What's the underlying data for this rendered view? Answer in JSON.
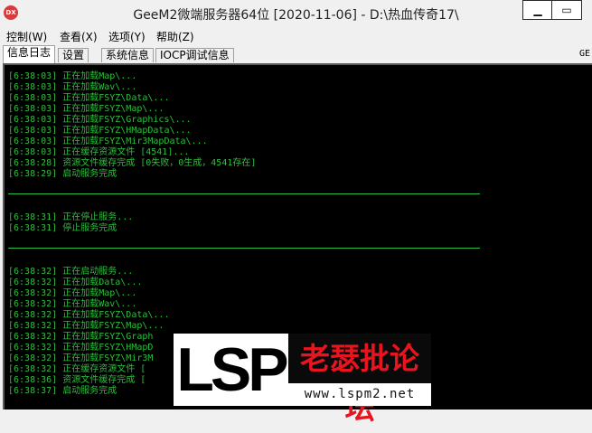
{
  "window": {
    "title": "GeeM2微端服务器64位 [2020-11-06] - D:\\热血传奇17\\",
    "app_icon": "DX",
    "minimize_symbol": "▁",
    "maximize_symbol": "▭"
  },
  "menu": {
    "items": [
      "控制(W)",
      "查看(X)",
      "选项(Y)",
      "帮助(Z)"
    ]
  },
  "tabs": {
    "items": [
      "信息日志",
      "设置",
      "系统信息",
      "IOCP调试信息"
    ],
    "active": "信息日志",
    "right_label": "GE"
  },
  "console": {
    "text_color": "#2dbe3c",
    "background": "#000000",
    "lines": [
      "[6:38:03] 正在加载Map\\...",
      "[6:38:03] 正在加载Wav\\...",
      "[6:38:03] 正在加载FSYZ\\Data\\...",
      "[6:38:03] 正在加载FSYZ\\Map\\...",
      "[6:38:03] 正在加载FSYZ\\Graphics\\...",
      "[6:38:03] 正在加载FSYZ\\HMapData\\...",
      "[6:38:03] 正在加载FSYZ\\Mir3MapData\\...",
      "[6:38:03] 正在缓存资源文件 [4541]...",
      "[6:38:28] 资源文件缓存完成 [0失败，0生成，4541存在]",
      "[6:38:29] 启动服务完成",
      "[6:38:31] 正在停止服务...",
      "[6:38:31] 停止服务完成",
      "[6:38:32] 正在启动服务...",
      "[6:38:32] 正在加载Data\\...",
      "[6:38:32] 正在加载Map\\...",
      "[6:38:32] 正在加载Wav\\...",
      "[6:38:32] 正在加载FSYZ\\Data\\...",
      "[6:38:32] 正在加载FSYZ\\Map\\...",
      "[6:38:32] 正在加载FSYZ\\Graph",
      "[6:38:32] 正在加载FSYZ\\HMapD",
      "[6:38:32] 正在加载FSYZ\\Mir3M",
      "[6:38:32] 正在缓存资源文件 [",
      "[6:38:36] 资源文件缓存完成 [",
      "[6:38:37] 启动服务完成"
    ]
  },
  "watermark": {
    "brand": "LSP",
    "name": "老瑟批论坛",
    "url": "www.lspm2.net",
    "colors": {
      "brand": "#000000",
      "name": "#e8141e",
      "url": "#111111"
    }
  }
}
